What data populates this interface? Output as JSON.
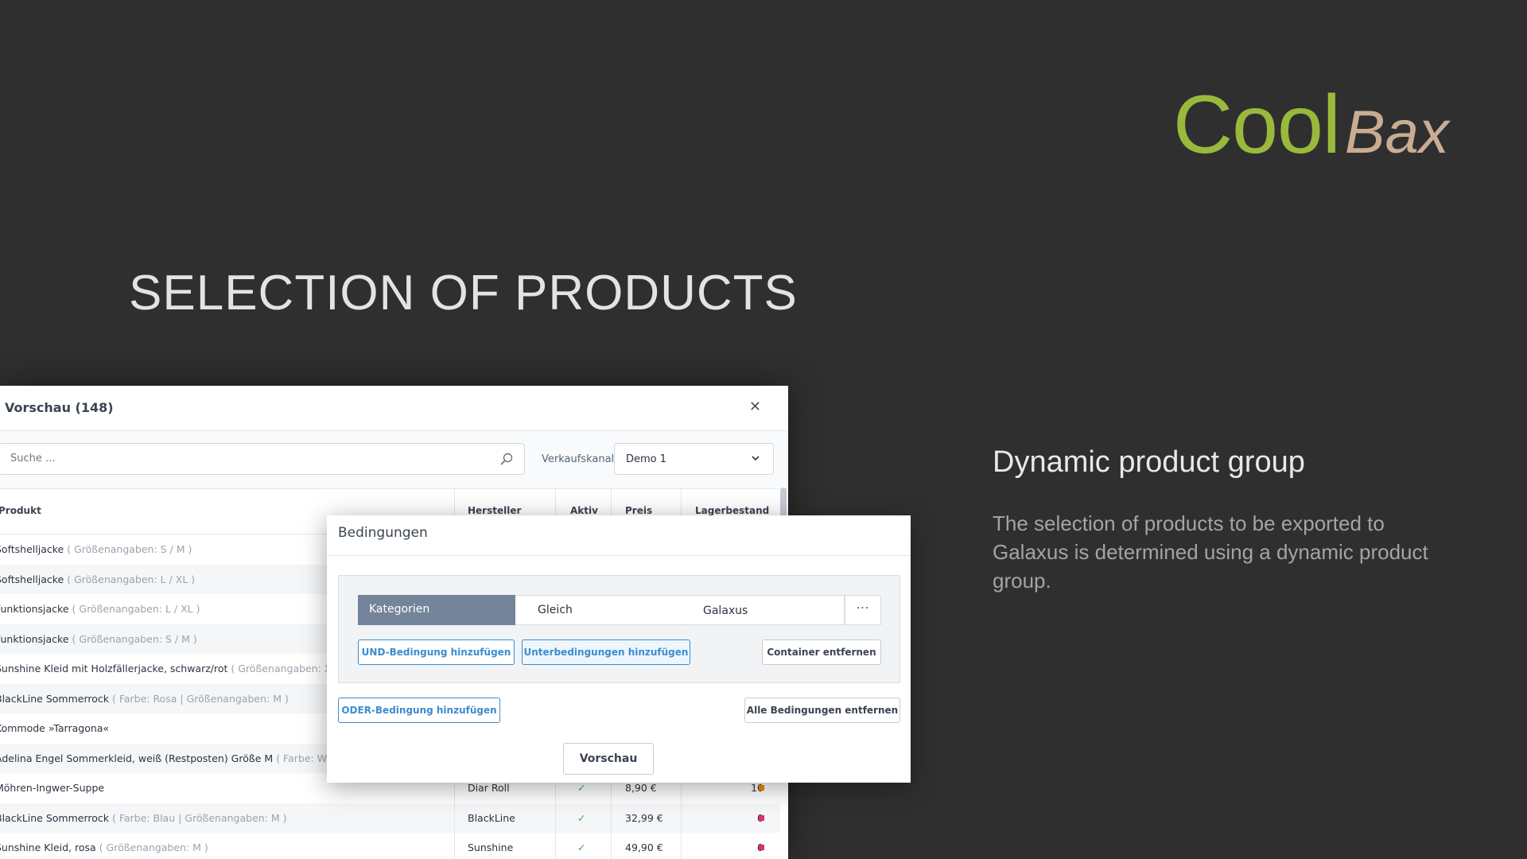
{
  "logo": {
    "part1": "Cool",
    "part2": "Bax",
    "color1": "#99b93c",
    "color2": "#c9ad92"
  },
  "headline": "SELECTION OF PRODUCTS",
  "right": {
    "title": "Dynamic product group",
    "body": "The selection of products to be exported to Galaxus is determined using a dynamic product group."
  },
  "preview": {
    "title": "Vorschau (148)",
    "close_icon": "close-icon",
    "search_placeholder": "Suche ...",
    "channel_label": "Verkaufskanal",
    "channel_value": "Demo 1",
    "columns": {
      "product": "Produkt",
      "manufacturer": "Hersteller",
      "active": "Aktiv",
      "price": "Preis",
      "stock": "Lagerbestand"
    },
    "rows": [
      {
        "name": "Softshelljacke",
        "variant": "( Größenangaben: S / M )",
        "manufacturer": "",
        "active": "",
        "price": "",
        "stock": "",
        "stock_color": ""
      },
      {
        "name": "Softshelljacke",
        "variant": "( Größenangaben: L / XL )",
        "manufacturer": "",
        "active": "",
        "price": "",
        "stock": "",
        "stock_color": ""
      },
      {
        "name": "Funktionsjacke",
        "variant": "( Größenangaben: L / XL )",
        "manufacturer": "",
        "active": "",
        "price": "",
        "stock": "",
        "stock_color": ""
      },
      {
        "name": "Funktionsjacke",
        "variant": "( Größenangaben: S / M )",
        "manufacturer": "",
        "active": "",
        "price": "",
        "stock": "",
        "stock_color": ""
      },
      {
        "name": "Sunshine Kleid mit Holzfällerjacke, schwarz/rot",
        "variant": "( Größenangaben: XS )",
        "manufacturer": "",
        "active": "",
        "price": "",
        "stock": "",
        "stock_color": ""
      },
      {
        "name": "BlackLine Sommerrock",
        "variant": "( Farbe: Rosa | Größenangaben: M )",
        "manufacturer": "",
        "active": "",
        "price": "",
        "stock": "",
        "stock_color": ""
      },
      {
        "name": "Kommode »Tarragona«",
        "variant": "",
        "manufacturer": "",
        "active": "",
        "price": "",
        "stock": "",
        "stock_color": ""
      },
      {
        "name": "Adelina Engel Sommerkleid, weiß (Restposten) Größe M",
        "variant": "( Farbe: Weiß",
        "manufacturer": "",
        "active": "",
        "price": "",
        "stock": "",
        "stock_color": ""
      },
      {
        "name": "Möhren-Ingwer-Suppe",
        "variant": "",
        "manufacturer": "Diar Roll",
        "active": "✓",
        "price": "8,90 €",
        "stock": "10",
        "stock_color": "#f08c00"
      },
      {
        "name": "BlackLine Sommerrock",
        "variant": "( Farbe: Blau | Größenangaben: M )",
        "manufacturer": "BlackLine",
        "active": "✓",
        "price": "32,99 €",
        "stock": "0",
        "stock_color": "#d6336c"
      },
      {
        "name": "Sunshine Kleid, rosa",
        "variant": "( Größenangaben: M )",
        "manufacturer": "Sunshine",
        "active": "✓",
        "price": "49,90 €",
        "stock": "0",
        "stock_color": "#d6336c"
      }
    ]
  },
  "conditions": {
    "title": "Bedingungen",
    "rule": {
      "field": "Kategorien",
      "operator": "Gleich",
      "value": "Galaxus",
      "more": "···"
    },
    "buttons": {
      "add_and": "UND-Bedingung hinzufügen",
      "add_sub": "Unterbedingungen hinzufügen",
      "remove_container": "Container entfernen",
      "add_or": "ODER-Bedingung hinzufügen",
      "remove_all": "Alle Bedingungen entfernen",
      "preview": "Vorschau"
    }
  }
}
